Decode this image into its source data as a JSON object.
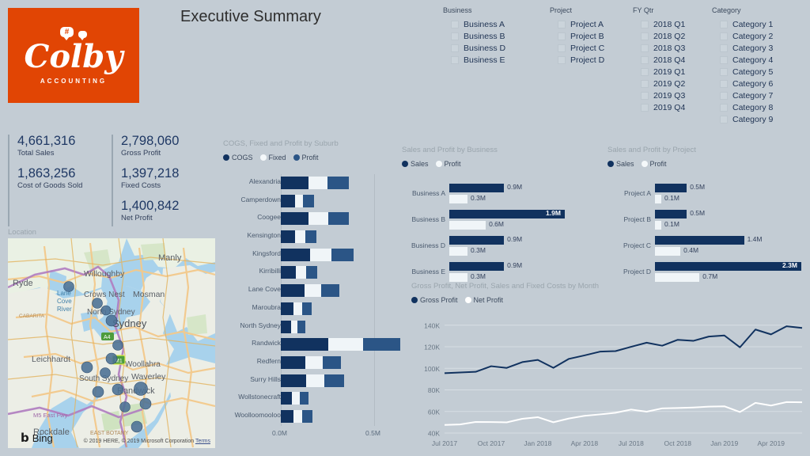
{
  "brand": {
    "logo_text": "Colby",
    "logo_sub": "ACCOUNTING",
    "logo_bubble_glyph": "#",
    "logo_bg": "#e14504"
  },
  "header": {
    "title": "Executive Summary"
  },
  "slicers": [
    {
      "name": "business",
      "title": "Business",
      "items": [
        "Business A",
        "Business B",
        "Business D",
        "Business E"
      ]
    },
    {
      "name": "project",
      "title": "Project",
      "items": [
        "Project A",
        "Project B",
        "Project C",
        "Project D"
      ]
    },
    {
      "name": "fy-qtr",
      "title": "FY Qtr",
      "items": [
        "2018 Q1",
        "2018 Q2",
        "2018 Q3",
        "2018 Q4",
        "2019 Q1",
        "2019 Q2",
        "2019 Q3",
        "2019 Q4"
      ]
    },
    {
      "name": "category",
      "title": "Category",
      "items": [
        "Category 1",
        "Category 2",
        "Category 3",
        "Category 4",
        "Category 5",
        "Category 6",
        "Category 7",
        "Category 8",
        "Category 9"
      ]
    }
  ],
  "kpis": {
    "left": [
      {
        "value": "4,661,316",
        "label": "Total Sales"
      },
      {
        "value": "1,863,256",
        "label": "Cost of Goods Sold"
      }
    ],
    "right": [
      {
        "value": "2,798,060",
        "label": "Gross Profit"
      },
      {
        "value": "1,397,218",
        "label": "Fixed Costs"
      },
      {
        "value": "1,400,842",
        "label": "Net Profit"
      }
    ]
  },
  "map": {
    "title": "Location",
    "provider": "Bing",
    "attribution": "© 2019 HERE, © 2019 Microsoft Corporation",
    "terms_label": "Terms",
    "place_labels": [
      "Manly",
      "Willoughby",
      "Ryde",
      "Lane Cove River",
      "Crows Nest",
      "Mosman",
      "North Sydney",
      "Sydney",
      "CABARITA",
      "Leichhardt",
      "Woollahra",
      "Waverley",
      "South Sydney",
      "Randwick",
      "M5 East Fwy",
      "Rockdale",
      "EAST BOTANY",
      "A4",
      "M1"
    ]
  },
  "colors": {
    "cogs": "#11325f",
    "fixed": "#f0f5f8",
    "profit": "#2b5586",
    "sales": "#11325f",
    "gross_profit": "#11325f",
    "net_profit": "#ffffff",
    "background": "#c3ccd4"
  },
  "chart_data": [
    {
      "name": "suburb",
      "type": "bar",
      "orientation": "horizontal",
      "stacked": true,
      "title": "COGS, Fixed and Profit by Suburb",
      "legend": [
        "COGS",
        "Fixed",
        "Profit"
      ],
      "legend_position": "top-left",
      "xlabel": "",
      "ylabel": "",
      "xlim": [
        0,
        0.6
      ],
      "xticks": [
        "0.0M",
        "0.5M"
      ],
      "xtick_values": [
        0.0,
        0.5
      ],
      "grid": true,
      "categories": [
        "Alexandria",
        "Camperdown",
        "Coogee",
        "Kensington",
        "Kingsford",
        "Kirribilli",
        "Lane Cove",
        "Maroubra",
        "North Sydney",
        "Randwick",
        "Redfern",
        "Surry Hills",
        "Wollstonecraft",
        "Woolloomooloo"
      ],
      "series": [
        {
          "name": "COGS",
          "values": [
            0.149,
            0.075,
            0.148,
            0.076,
            0.156,
            0.08,
            0.126,
            0.068,
            0.055,
            0.254,
            0.132,
            0.135,
            0.06,
            0.068
          ]
        },
        {
          "name": "Fixed",
          "values": [
            0.1,
            0.045,
            0.105,
            0.054,
            0.115,
            0.055,
            0.092,
            0.047,
            0.036,
            0.186,
            0.093,
            0.1,
            0.042,
            0.048
          ]
        },
        {
          "name": "Profit",
          "values": [
            0.114,
            0.058,
            0.112,
            0.06,
            0.118,
            0.059,
            0.094,
            0.051,
            0.041,
            0.198,
            0.098,
            0.105,
            0.046,
            0.052
          ]
        }
      ]
    },
    {
      "name": "business",
      "type": "bar",
      "orientation": "horizontal",
      "title": "Sales and Profit by Business",
      "legend": [
        "Sales",
        "Profit"
      ],
      "legend_position": "top-left",
      "categories": [
        "Business A",
        "Business B",
        "Business D",
        "Business E"
      ],
      "series": [
        {
          "name": "Sales",
          "values": [
            0.9,
            1.9,
            0.9,
            0.9
          ],
          "labels": [
            "0.9M",
            "1.9M",
            "0.9M",
            "0.9M"
          ]
        },
        {
          "name": "Profit",
          "values": [
            0.3,
            0.6,
            0.3,
            0.3
          ],
          "labels": [
            "0.3M",
            "0.6M",
            "0.3M",
            "0.3M"
          ]
        }
      ],
      "xlim": [
        0,
        1.9
      ]
    },
    {
      "name": "project",
      "type": "bar",
      "orientation": "horizontal",
      "title": "Sales and Profit by Project",
      "legend": [
        "Sales",
        "Profit"
      ],
      "legend_position": "top-left",
      "categories": [
        "Project A",
        "Project B",
        "Project C",
        "Project D"
      ],
      "series": [
        {
          "name": "Sales",
          "values": [
            0.5,
            0.5,
            1.4,
            2.3
          ],
          "labels": [
            "0.5M",
            "0.5M",
            "1.4M",
            "2.3M"
          ]
        },
        {
          "name": "Profit",
          "values": [
            0.1,
            0.1,
            0.4,
            0.7
          ],
          "labels": [
            "0.1M",
            "0.1M",
            "0.4M",
            "0.7M"
          ]
        }
      ],
      "xlim": [
        0,
        2.3
      ]
    },
    {
      "name": "monthly-trend",
      "type": "line",
      "title": "Gross Profit, Net Profit, Sales and Fixed Costs by Month",
      "legend": [
        "Gross Profit",
        "Net Profit"
      ],
      "legend_position": "top-left",
      "xlabel": "",
      "ylabel": "",
      "ylim": [
        40000,
        145000
      ],
      "yticks": [
        "40K",
        "60K",
        "80K",
        "100K",
        "120K",
        "140K"
      ],
      "ytick_values": [
        40000,
        60000,
        80000,
        100000,
        120000,
        140000
      ],
      "grid": true,
      "xticks": [
        "Jul 2017",
        "Oct 2017",
        "Jan 2018",
        "Apr 2018",
        "Jul 2018",
        "Oct 2018",
        "Jan 2019",
        "Apr 2019"
      ],
      "x": [
        "Jul 2017",
        "Aug 2017",
        "Sep 2017",
        "Oct 2017",
        "Nov 2017",
        "Dec 2017",
        "Jan 2018",
        "Feb 2018",
        "Mar 2018",
        "Apr 2018",
        "May 2018",
        "Jun 2018",
        "Jul 2018",
        "Aug 2018",
        "Sep 2018",
        "Oct 2018",
        "Nov 2018",
        "Dec 2018",
        "Jan 2019",
        "Feb 2019",
        "Mar 2019",
        "Apr 2019",
        "May 2019",
        "Jun 2019"
      ],
      "series": [
        {
          "name": "Gross Profit",
          "values": [
            95500,
            96200,
            96800,
            102000,
            100400,
            105800,
            107800,
            100500,
            108800,
            112000,
            115500,
            116000,
            120000,
            123800,
            121000,
            126500,
            125500,
            129500,
            130500,
            119500,
            136000,
            131500,
            139000,
            137500
          ]
        },
        {
          "name": "Net Profit",
          "values": [
            47500,
            48000,
            50300,
            50200,
            49900,
            53200,
            54700,
            50000,
            53500,
            56000,
            57300,
            58800,
            61800,
            59800,
            62900,
            63200,
            63700,
            64500,
            64800,
            59500,
            68000,
            65500,
            68700,
            68500
          ]
        }
      ]
    }
  ]
}
